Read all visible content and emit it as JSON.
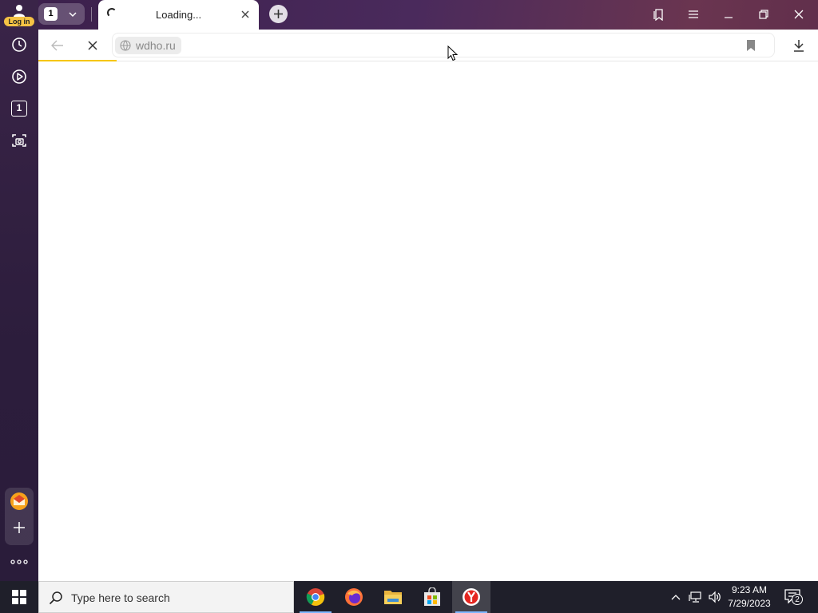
{
  "sidebar": {
    "login_label": "Log in",
    "items": [
      {
        "name": "history",
        "icon": "clock-icon"
      },
      {
        "name": "video",
        "icon": "play-icon"
      },
      {
        "name": "tab-count",
        "icon": "square-one-icon",
        "label": "1"
      },
      {
        "name": "screenshot",
        "icon": "camera-icon"
      }
    ],
    "bottom": [
      {
        "name": "mail-app",
        "icon": "envelope-icon"
      },
      {
        "name": "add-panel",
        "icon": "plus-icon"
      },
      {
        "name": "more",
        "icon": "dots-icon"
      }
    ]
  },
  "tabstrip": {
    "tab_count": "1",
    "active_tab_title": "Loading...",
    "new_tab": "new-tab"
  },
  "toolbar": {
    "url": "wdho.ru",
    "load_progress": 0.1
  },
  "taskbar": {
    "search_placeholder": "Type here to search",
    "apps": [
      "chrome",
      "firefox",
      "file-explorer",
      "microsoft-store",
      "yandex-browser"
    ],
    "active_app": "yandex-browser",
    "time": "9:23 AM",
    "date": "7/29/2023",
    "notification_count": "2"
  },
  "colors": {
    "accent_yellow": "#f6c600",
    "login_badge": "#f6c344",
    "taskbar": "#1f1f2a"
  }
}
